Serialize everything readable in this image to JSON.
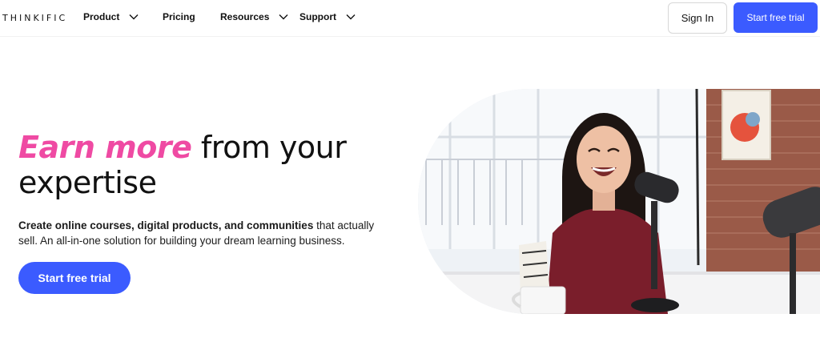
{
  "nav": {
    "logo": "THINKIFIC",
    "items": [
      {
        "label": "Product",
        "dropdown": true
      },
      {
        "label": "Pricing",
        "dropdown": false
      },
      {
        "label": "Resources",
        "dropdown": true
      },
      {
        "label": "Support",
        "dropdown": true
      }
    ],
    "sign_in": "Sign In",
    "start_trial": "Start free trial"
  },
  "hero": {
    "headline_accent": "Earn more",
    "headline_rest": " from your expertise",
    "subtitle_bold": "Create online courses, digital products, and communities",
    "subtitle_rest": " that actually sell. An all-in-one solution for building your dream learning business.",
    "cta": "Start free trial",
    "image_alt": "Woman laughing while recording a podcast with microphones"
  },
  "colors": {
    "accent_pink": "#ef4aa3",
    "brand_blue": "#3b5bff"
  }
}
